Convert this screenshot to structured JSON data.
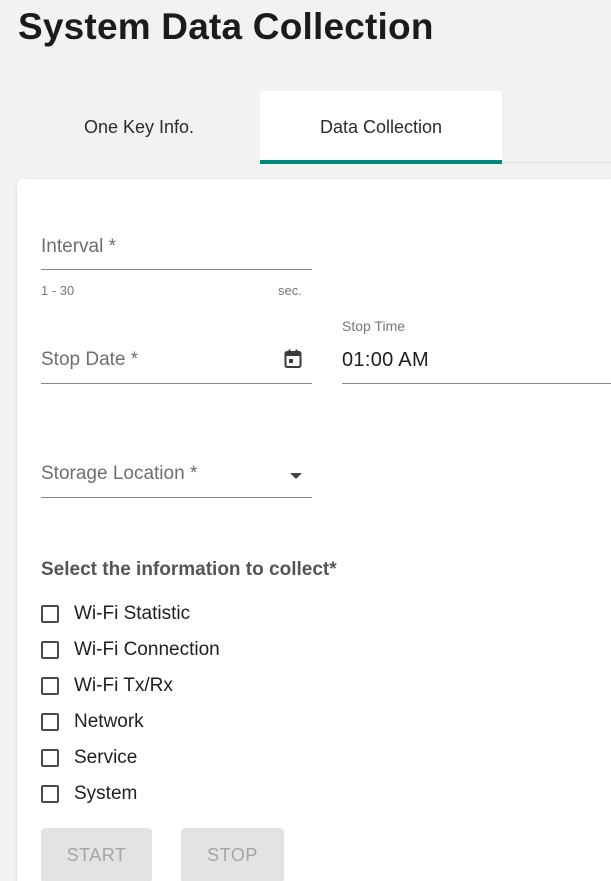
{
  "page": {
    "title": "System Data Collection"
  },
  "tabs": [
    {
      "label": "One Key Info.",
      "active": false
    },
    {
      "label": "Data Collection",
      "active": true
    }
  ],
  "colors": {
    "accent": "#00897b",
    "background": "#f2f2f2",
    "card": "#ffffff"
  },
  "form": {
    "interval": {
      "label": "Interval *",
      "hint_range": "1 - 30",
      "hint_unit": "sec.",
      "value": ""
    },
    "stop_date": {
      "label": "Stop Date *",
      "icon": "calendar-icon",
      "value": ""
    },
    "stop_time": {
      "label": "Stop Time",
      "value": "01:00  AM"
    },
    "storage_location": {
      "label": "Storage Location *",
      "icon": "dropdown-arrow-icon",
      "value": ""
    },
    "collect": {
      "title": "Select the information to collect*",
      "items": [
        {
          "label": "Wi-Fi Statistic",
          "checked": false
        },
        {
          "label": "Wi-Fi Connection",
          "checked": false
        },
        {
          "label": "Wi-Fi Tx/Rx",
          "checked": false
        },
        {
          "label": "Network",
          "checked": false
        },
        {
          "label": "Service",
          "checked": false
        },
        {
          "label": "System",
          "checked": false
        }
      ]
    }
  },
  "buttons": {
    "start": "START",
    "stop": "STOP"
  }
}
